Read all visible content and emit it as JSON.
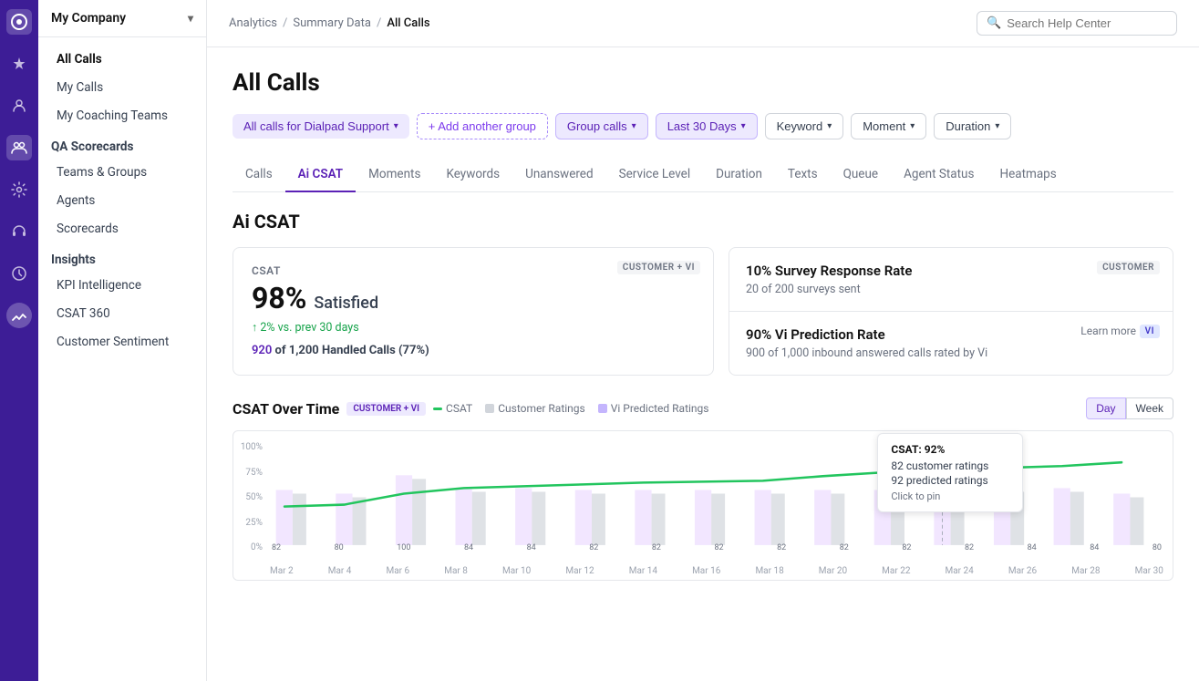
{
  "iconBar": {
    "icons": [
      {
        "name": "logo",
        "symbol": "◉"
      },
      {
        "name": "home",
        "symbol": "✦"
      },
      {
        "name": "person",
        "symbol": "👤"
      },
      {
        "name": "team",
        "symbol": "👥"
      },
      {
        "name": "settings",
        "symbol": "⚙"
      },
      {
        "name": "headset",
        "symbol": "🎧"
      },
      {
        "name": "clock",
        "symbol": "🕐"
      },
      {
        "name": "analytics",
        "symbol": "📈"
      }
    ]
  },
  "sidebar": {
    "company": "My Company",
    "navItems": [
      {
        "label": "All Calls",
        "active": true
      },
      {
        "label": "My Calls",
        "active": false
      },
      {
        "label": "My Coaching Teams",
        "active": false
      }
    ],
    "sections": [
      {
        "title": "QA Scorecards",
        "items": [
          {
            "label": "Teams & Groups"
          },
          {
            "label": "Agents"
          },
          {
            "label": "Scorecards"
          }
        ]
      },
      {
        "title": "Insights",
        "items": [
          {
            "label": "KPI Intelligence"
          },
          {
            "label": "CSAT 360"
          },
          {
            "label": "Customer Sentiment"
          }
        ]
      }
    ]
  },
  "topbar": {
    "breadcrumb": {
      "parts": [
        "Analytics",
        "Summary Data",
        "All Calls"
      ]
    },
    "search": {
      "placeholder": "Search Help Center"
    }
  },
  "page": {
    "title": "All Calls"
  },
  "filters": {
    "group": "All calls for Dialpad Support",
    "addGroup": "+ Add another group",
    "groupCalls": "Group calls",
    "dateRange": "Last 30 Days",
    "keyword": "Keyword",
    "moment": "Moment",
    "duration": "Duration"
  },
  "tabs": [
    {
      "label": "Calls",
      "active": false
    },
    {
      "label": "Ai CSAT",
      "active": true
    },
    {
      "label": "Moments",
      "active": false
    },
    {
      "label": "Keywords",
      "active": false
    },
    {
      "label": "Unanswered",
      "active": false
    },
    {
      "label": "Service Level",
      "active": false
    },
    {
      "label": "Duration",
      "active": false
    },
    {
      "label": "Texts",
      "active": false
    },
    {
      "label": "Queue",
      "active": false
    },
    {
      "label": "Agent Status",
      "active": false
    },
    {
      "label": "Heatmaps",
      "active": false
    }
  ],
  "aiCsat": {
    "sectionTitle": "Ai CSAT",
    "mainCard": {
      "badge": "CUSTOMER + VI",
      "label": "CSAT",
      "percentage": "98%",
      "satisfiedLabel": "Satisfied",
      "trend": "↑ 2% vs. prev 30 days",
      "handledPrefix": "920",
      "handledOf": "of 1,200 Handled Calls",
      "handledSuffix": "(77%)"
    },
    "surveyCard": {
      "badge": "CUSTOMER",
      "title": "10% Survey Response Rate",
      "sub": "20 of 200 surveys sent"
    },
    "predictionCard": {
      "badge": "VI",
      "title": "90% Vi Prediction Rate",
      "sub": "900 of 1,000 inbound answered calls rated by Vi",
      "learnMore": "Learn more"
    }
  },
  "chart": {
    "title": "CSAT Over Time",
    "badge": "CUSTOMER + VI",
    "legend": {
      "csat": "CSAT",
      "customerRatings": "Customer Ratings",
      "viPredicted": "Vi Predicted Ratings"
    },
    "toggleDay": "Day",
    "toggleWeek": "Week",
    "yLabels": [
      "100%",
      "75%",
      "50%",
      "25%",
      "0%"
    ],
    "xLabels": [
      "Mar 2",
      "Mar 4",
      "Mar 6",
      "Mar 8",
      "Mar 10",
      "Mar 12",
      "Mar 14",
      "Mar 16",
      "Mar 18",
      "Mar 20",
      "Mar 22",
      "Mar 24",
      "Mar 26",
      "Mar 28",
      "Mar 30"
    ],
    "barValues": [
      82,
      80,
      100,
      84,
      84,
      82,
      82,
      82,
      82,
      82,
      82,
      82,
      84,
      84,
      80
    ],
    "tooltip": {
      "title": "CSAT: 92%",
      "customerRatings": "82 customer ratings",
      "predictedRatings": "92 predicted ratings",
      "pin": "Click to pin"
    }
  }
}
